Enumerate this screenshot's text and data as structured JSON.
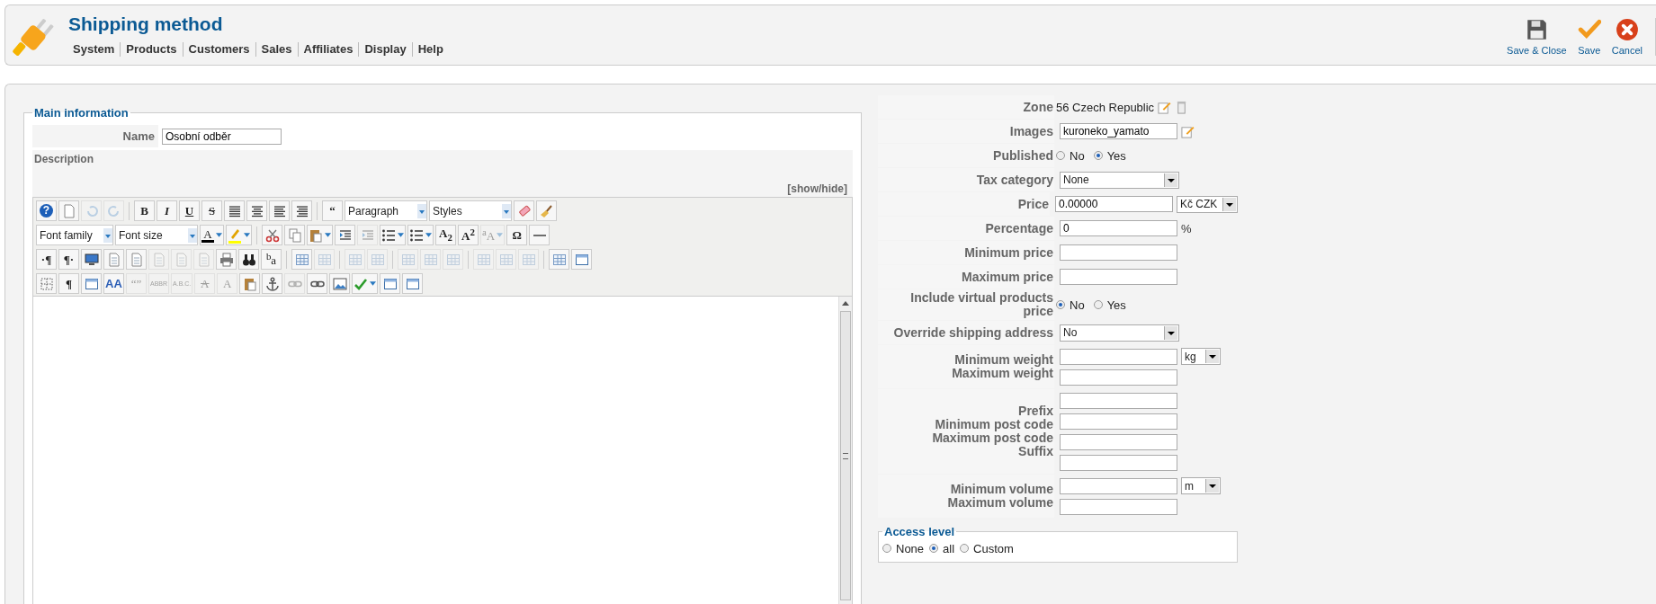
{
  "header": {
    "title": "Shipping method",
    "menu": [
      "System",
      "Products",
      "Customers",
      "Sales",
      "Affiliates",
      "Display",
      "Help"
    ],
    "actions": [
      {
        "kind": "save_close",
        "label": "Save & Close"
      },
      {
        "kind": "save",
        "label": "Save"
      },
      {
        "kind": "cancel",
        "label": "Cancel"
      }
    ]
  },
  "main_information": {
    "legend": "Main information",
    "name": {
      "label": "Name",
      "value": "Osobní odběr"
    },
    "description": {
      "label": "Description",
      "toggle": "[show/hide]",
      "toolbar": [
        [
          {
            "kind": "glyph_circle",
            "glyph": "?",
            "disabled": false
          },
          {
            "kind": "page",
            "disabled": false
          },
          {
            "kind": "undo",
            "disabled": true
          },
          {
            "kind": "redo",
            "disabled": true
          },
          {
            "kind": "sep"
          },
          {
            "kind": "glyph_bold",
            "glyph": "B",
            "disabled": false
          },
          {
            "kind": "glyph_italic",
            "glyph": "I",
            "disabled": false
          },
          {
            "kind": "glyph_underline",
            "glyph": "U",
            "disabled": false
          },
          {
            "kind": "glyph_strike",
            "glyph": "S",
            "disabled": false
          },
          {
            "kind": "align_justify",
            "disabled": false
          },
          {
            "kind": "align_center",
            "disabled": false
          },
          {
            "kind": "align_left",
            "disabled": false
          },
          {
            "kind": "align_right",
            "disabled": false
          },
          {
            "kind": "sep"
          },
          {
            "kind": "glyph_bold",
            "glyph": "“",
            "disabled": false
          },
          {
            "kind": "select",
            "label": "Paragraph"
          },
          {
            "kind": "select",
            "label": "Styles"
          },
          {
            "kind": "eraser",
            "disabled": false
          },
          {
            "kind": "broom",
            "disabled": false
          }
        ],
        [
          {
            "kind": "select",
            "label": "Font family"
          },
          {
            "kind": "select",
            "label": "Font size"
          },
          {
            "kind": "color",
            "glyph": "A",
            "color": "#000000",
            "split": true,
            "disabled": false
          },
          {
            "kind": "highlight",
            "color": "#ffff00",
            "split": true,
            "disabled": false
          },
          {
            "kind": "sep"
          },
          {
            "kind": "cut",
            "disabled": false
          },
          {
            "kind": "copy",
            "disabled": false
          },
          {
            "kind": "paste",
            "split": true,
            "disabled": false
          },
          {
            "kind": "indent",
            "disabled": false
          },
          {
            "kind": "indent",
            "disabled": true
          },
          {
            "kind": "numbered_list",
            "split": true,
            "disabled": false
          },
          {
            "kind": "bullet_list",
            "split": true,
            "disabled": false
          },
          {
            "kind": "glyph_bold",
            "glyph": "A$_{2}$",
            "disabled": false
          },
          {
            "kind": "glyph_bold",
            "glyph": "A$^{2}$",
            "disabled": false
          },
          {
            "kind": "glyph_plain",
            "glyph": "$^{a}$A",
            "split": true,
            "disabled": true
          },
          {
            "kind": "glyph_bold",
            "glyph": "Ω",
            "disabled": false
          },
          {
            "kind": "rule",
            "disabled": false
          }
        ],
        [
          {
            "kind": "glyph_bold",
            "glyph": "·¶",
            "disabled": false
          },
          {
            "kind": "glyph_bold",
            "glyph": "¶·",
            "disabled": false
          },
          {
            "kind": "monitor",
            "disabled": false
          },
          {
            "kind": "document",
            "disabled": false
          },
          {
            "kind": "document",
            "disabled": false
          },
          {
            "kind": "document",
            "disabled": true
          },
          {
            "kind": "document",
            "disabled": true
          },
          {
            "kind": "document",
            "disabled": true
          },
          {
            "kind": "printer",
            "disabled": false
          },
          {
            "kind": "binoculars",
            "disabled": false
          },
          {
            "kind": "glyph_plain",
            "glyph": "$^{b}$a",
            "disabled": false
          },
          {
            "kind": "sep"
          },
          {
            "kind": "table",
            "disabled": false
          },
          {
            "kind": "table",
            "disabled": true
          },
          {
            "kind": "sep"
          },
          {
            "kind": "table",
            "disabled": true
          },
          {
            "kind": "table",
            "disabled": true
          },
          {
            "kind": "sep"
          },
          {
            "kind": "table",
            "disabled": true
          },
          {
            "kind": "table",
            "disabled": true
          },
          {
            "kind": "table",
            "disabled": true
          },
          {
            "kind": "sep"
          },
          {
            "kind": "table",
            "disabled": true
          },
          {
            "kind": "table",
            "disabled": true
          },
          {
            "kind": "table",
            "disabled": true
          },
          {
            "kind": "sep"
          },
          {
            "kind": "table",
            "disabled": false
          },
          {
            "kind": "panel",
            "disabled": false
          }
        ],
        [
          {
            "kind": "dashed_box",
            "disabled": false
          },
          {
            "kind": "glyph_bold",
            "glyph": "¶",
            "disabled": false
          },
          {
            "kind": "panel",
            "disabled": false
          },
          {
            "kind": "glyph_blue",
            "glyph": "AA",
            "disabled": false
          },
          {
            "kind": "glyph_plain",
            "glyph": "“”",
            "disabled": true
          },
          {
            "kind": "glyph_tiny",
            "glyph": "ABBR",
            "disabled": true
          },
          {
            "kind": "glyph_tiny",
            "glyph": "A.B.C.",
            "disabled": true
          },
          {
            "kind": "glyph_strike",
            "glyph": "A",
            "disabled": true
          },
          {
            "kind": "glyph_plain",
            "glyph": "A",
            "disabled": true
          },
          {
            "kind": "paste",
            "disabled": false
          },
          {
            "kind": "anchor",
            "disabled": false
          },
          {
            "kind": "link",
            "disabled": true
          },
          {
            "kind": "link",
            "disabled": false
          },
          {
            "kind": "picture",
            "disabled": false
          },
          {
            "kind": "spellcheck",
            "split": true,
            "disabled": false
          },
          {
            "kind": "panel",
            "disabled": false
          },
          {
            "kind": "panel",
            "disabled": false
          }
        ]
      ]
    }
  },
  "form": {
    "rows": [
      {
        "kind": "zone",
        "label": "Zone",
        "value": "56 Czech Republic"
      },
      {
        "kind": "input_edit",
        "label": "Images",
        "value": "kuroneko_yamato"
      },
      {
        "kind": "radio",
        "label": "Published",
        "options": [
          {
            "label": "No",
            "selected": false
          },
          {
            "label": "Yes",
            "selected": true
          }
        ]
      },
      {
        "kind": "select",
        "label": "Tax category",
        "value": "None"
      },
      {
        "kind": "input",
        "label": "Price",
        "value": "0.00000",
        "unit": "Kč CZK"
      },
      {
        "kind": "input",
        "label": "Percentage",
        "value": "0",
        "suffix": "%"
      },
      {
        "kind": "input",
        "label": "Minimum price"
      },
      {
        "kind": "input",
        "label": "Maximum price"
      },
      {
        "kind": "radio",
        "label": "Include virtual products price",
        "options": [
          {
            "label": "No",
            "selected": true
          },
          {
            "label": "Yes",
            "selected": false
          }
        ]
      },
      {
        "kind": "select",
        "label": "Override shipping address",
        "value": "No"
      },
      {
        "kind": "group",
        "fields": [
          {
            "label": "Minimum weight"
          },
          {
            "label": "Maximum weight"
          }
        ],
        "unit": "kg"
      },
      {
        "kind": "group",
        "fields": [
          {
            "label": "Prefix"
          },
          {
            "label": "Minimum post code"
          },
          {
            "label": "Maximum post code"
          },
          {
            "label": "Suffix"
          }
        ]
      },
      {
        "kind": "group",
        "fields": [
          {
            "label": "Minimum volume"
          },
          {
            "label": "Maximum volume"
          }
        ],
        "unit": "m"
      }
    ]
  },
  "access_level": {
    "legend": "Access level",
    "options": [
      {
        "label": "None",
        "selected": false
      },
      {
        "label": "all",
        "selected": true
      },
      {
        "label": "Custom",
        "selected": false
      }
    ]
  }
}
